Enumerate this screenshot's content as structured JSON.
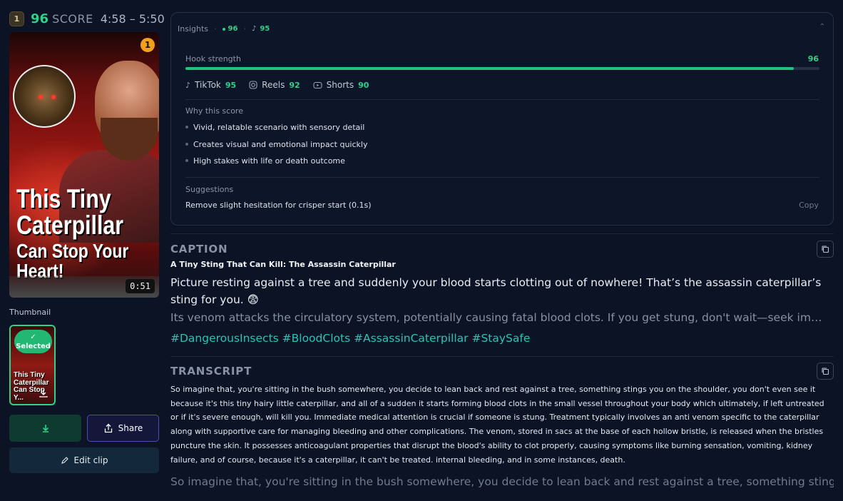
{
  "score_header": {
    "rank": "1",
    "score": "96",
    "score_label": "SCORE",
    "time_range": "4:58 – 5:50"
  },
  "thumbnail": {
    "rank_badge": "1",
    "headline_lines": [
      "This Tiny",
      "Caterpillar",
      "Can Stop Your",
      "Heart!"
    ],
    "duration": "0:51",
    "label": "Thumbnail",
    "selected_label": "Selected",
    "mini_lines": [
      "This Tiny",
      "Caterpillar",
      "Can Stop Y..."
    ]
  },
  "actions": {
    "share_label": "Share",
    "edit_label": "Edit clip"
  },
  "insights": {
    "title": "Insights",
    "overall": "96",
    "tiktok_summary": "95",
    "hook_label": "Hook strength",
    "hook_value": "96",
    "hook_fraction": 0.96,
    "platforms": [
      {
        "name": "TikTok",
        "value": "95",
        "icon": "tiktok-icon"
      },
      {
        "name": "Reels",
        "value": "92",
        "icon": "instagram-icon"
      },
      {
        "name": "Shorts",
        "value": "90",
        "icon": "youtube-icon"
      }
    ],
    "why_label": "Why this score",
    "reasons": [
      "Vivid, relatable scenario with sensory detail",
      "Creates visual and emotional impact quickly",
      "High stakes with life or death outcome"
    ],
    "suggestions_label": "Suggestions",
    "suggestion": "Remove slight hesitation for crisper start (0.1s)",
    "copy_label": "Copy"
  },
  "caption": {
    "section_title": "CAPTION",
    "headline": "A Tiny Sting That Can Kill: The Assassin Caterpillar",
    "main": "Picture resting against a tree and suddenly your blood starts clotting out of nowhere! That’s the assassin caterpillar’s sting for you. 😨",
    "more": "Its venom attacks the circulatory system, potentially causing fatal blood clots. If you get stung, don't wait—seek immediate medical attention.",
    "hashtags": "#DangerousInsects #BloodClots #AssassinCaterpillar #StaySafe"
  },
  "transcript": {
    "section_title": "TRANSCRIPT",
    "body": "So imagine that, you're sitting in the bush somewhere, you decide to lean back and rest against a tree, something stings you on the shoulder, you don't even see it because it's this tiny hairy little caterpillar, and all of a sudden it starts forming blood clots in the small vessel throughout your body which ultimately, if left untreated or if it's severe enough, will kill you. Immediate medical attention is crucial if someone is stung. Treatment typically involves an anti venom specific to the caterpillar along with supportive care for managing bleeding and other complications. The venom, stored in sacs at the base of each hollow bristle, is released when the bristles puncture the skin. It possesses anticoagulant properties that disrupt the blood's ability to clot properly, causing symptoms like burning sensation, vomiting, kidney failure, and of course, because it's a caterpillar, it can't be treated. internal bleeding, and in some instances, death.",
    "subtitle_preview": "So imagine that, you're sitting in the bush somewhere, you decide to lean back and rest against a tree, something stings"
  },
  "colors": {
    "accent_green": "#2fd18a",
    "hashtag": "#27c6b4",
    "background": "#0b1324"
  }
}
